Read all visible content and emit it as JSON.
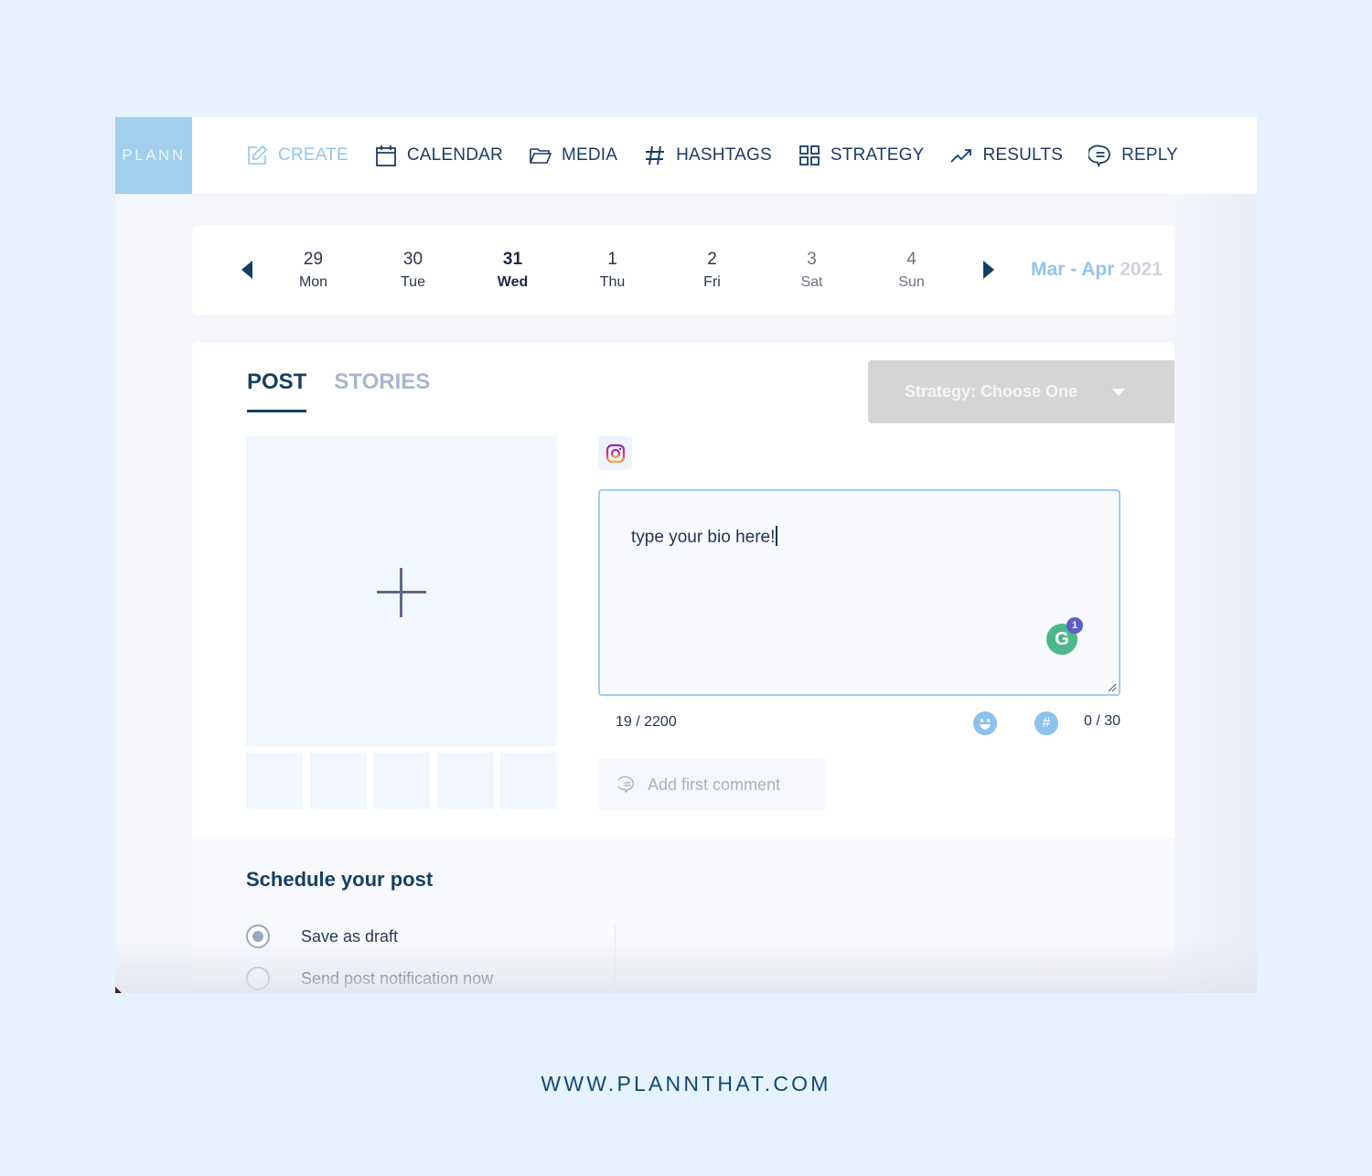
{
  "app": {
    "logo": "PLANN"
  },
  "nav": {
    "items": [
      {
        "label": "CREATE",
        "icon": "edit-icon",
        "active": true
      },
      {
        "label": "CALENDAR",
        "icon": "calendar-icon",
        "active": false
      },
      {
        "label": "MEDIA",
        "icon": "folder-icon",
        "active": false
      },
      {
        "label": "HASHTAGS",
        "icon": "hashtag-icon",
        "active": false
      },
      {
        "label": "STRATEGY",
        "icon": "grid-icon",
        "active": false
      },
      {
        "label": "RESULTS",
        "icon": "trend-icon",
        "active": false
      },
      {
        "label": "REPLY",
        "icon": "chat-icon",
        "active": false
      }
    ]
  },
  "week": {
    "days": [
      {
        "num": "29",
        "name": "Mon"
      },
      {
        "num": "30",
        "name": "Tue"
      },
      {
        "num": "31",
        "name": "Wed",
        "today": true
      },
      {
        "num": "1",
        "name": "Thu"
      },
      {
        "num": "2",
        "name": "Fri"
      },
      {
        "num": "3",
        "name": "Sat"
      },
      {
        "num": "4",
        "name": "Sun"
      }
    ],
    "range_months": "Mar - Apr",
    "range_year": "2021"
  },
  "composer": {
    "tabs": [
      {
        "label": "POST",
        "active": true
      },
      {
        "label": "STORIES",
        "active": false
      }
    ],
    "strategy_label": "Strategy: Choose One",
    "caption_text": "type your bio here!",
    "grammarly_badge": "1",
    "char_count": "19 / 2200",
    "hashtag_count": "0 / 30",
    "hash_symbol": "#",
    "add_comment_label": "Add first comment"
  },
  "schedule": {
    "title": "Schedule your post",
    "options": [
      {
        "label": "Save as draft",
        "checked": true
      },
      {
        "label": "Send post notification now",
        "checked": false
      }
    ]
  },
  "footer": {
    "url": "WWW.PLANNTHAT.COM"
  },
  "colors": {
    "brand_light": "#a3cfee",
    "navy": "#173f63",
    "accent_blue": "#8cc2ee",
    "grammarly_green": "#4bb98a"
  }
}
